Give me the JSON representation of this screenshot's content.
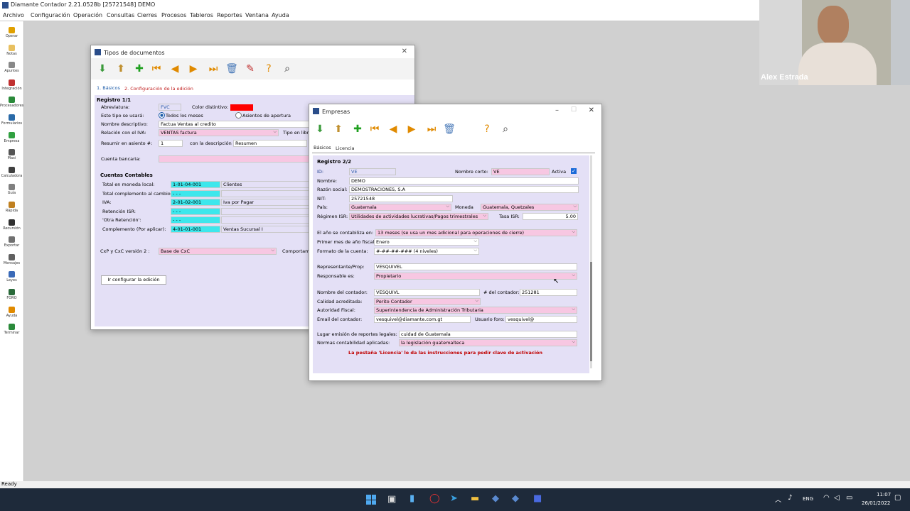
{
  "app": {
    "title": "Diamante Contador 2.21.0528b [25721548] DEMO",
    "menu": [
      "Archivo",
      "Configuración",
      "Operación",
      "Consultas",
      "Cierres",
      "Procesos",
      "Tableros",
      "Reportes",
      "Ventana",
      "Ayuda"
    ],
    "status": "Ready"
  },
  "sidebar": [
    {
      "label": "Operar",
      "icon": "lightning-icon",
      "color": "#e0a000"
    },
    {
      "label": "Notas",
      "icon": "note-icon",
      "color": "#e8c060"
    },
    {
      "label": "Apuntes",
      "icon": "document-icon",
      "color": "#888888"
    },
    {
      "label": "Integración",
      "icon": "integration-icon",
      "color": "#c03030"
    },
    {
      "label": "Procesadores",
      "icon": "excel-icon",
      "color": "#2a8a3a"
    },
    {
      "label": "Formularios",
      "icon": "form-icon",
      "color": "#2a6aa8"
    },
    {
      "label": "Empresa",
      "icon": "company-icon",
      "color": "#30a040"
    },
    {
      "label": "Maxi",
      "icon": "tree-icon",
      "color": "#555555"
    },
    {
      "label": "Calculadora",
      "icon": "calculator-icon",
      "color": "#404040"
    },
    {
      "label": "Guía",
      "icon": "guide-icon",
      "color": "#808080"
    },
    {
      "label": "Rápida",
      "icon": "quick-icon",
      "color": "#c08020"
    },
    {
      "label": "Recursión",
      "icon": "binoculars-icon",
      "color": "#303030"
    },
    {
      "label": "Exportar",
      "icon": "export-icon",
      "color": "#707070"
    },
    {
      "label": "Mensajes",
      "icon": "search-icon",
      "color": "#606060"
    },
    {
      "label": "Leyes",
      "icon": "law-icon",
      "color": "#3a6ab8"
    },
    {
      "label": "FORO",
      "icon": "forum-icon",
      "color": "#2a6a3a"
    },
    {
      "label": "Ayuda",
      "icon": "help-icon",
      "color": "#e08a00"
    },
    {
      "label": "Terminar",
      "icon": "exit-icon",
      "color": "#2a8a3a"
    }
  ],
  "tipos": {
    "title": "Tipos de documentos",
    "tabs": [
      "1. Básicos",
      "2. Configuración de la edición"
    ],
    "registro": "Registro 1/1",
    "abreviatura_label": "Abreviatura:",
    "abreviatura": "FVC",
    "color_label": "Color distintivo:",
    "color_value": "#ff0000",
    "usara_label": "Este tipo se usará:",
    "radio1": "Todos los meses",
    "radio2": "Asientos de apertura",
    "nombre_label": "Nombre descriptivo:",
    "nombre": "Factua Ventas al credito",
    "iva_rel_label": "Relación con el IVA:",
    "iva_rel": "VENTAS factura",
    "tipo_libro_label": "Tipo en libro",
    "resumir_label": "Resumir en asiento #:",
    "resumir": "1",
    "con_desc_label": "con la descripción",
    "con_desc": "Resumen",
    "cuenta_bancaria_label": "Cuenta bancaria:",
    "cuentas_title": "Cuentas Contables",
    "cuentas": [
      {
        "label": "Total en moneda local:",
        "code": "1-01-04-001",
        "name": "Clientes"
      },
      {
        "label": "Total complemento al cambio:",
        "code": "- - -",
        "name": ""
      },
      {
        "label": "IVA:",
        "code": "2-01-02-001",
        "name": "Iva por Pagar"
      },
      {
        "label": "Retención ISR:",
        "code": "- - -",
        "name": ""
      },
      {
        "label": "'Otra Retención':",
        "code": "- - -",
        "name": ""
      },
      {
        "label": "Complemento (Por aplicar):",
        "code": "4-01-01-001",
        "name": "Ventas Sucursal I"
      }
    ],
    "cxp_label": "CxP y CxC versión 2 :",
    "cxp": "Base de CxC",
    "comportam_label": "Comportam",
    "ir_button": "Ir configurar la edición"
  },
  "empresas": {
    "title": "Empresas",
    "tabs": [
      "Básicos",
      "Licencia"
    ],
    "registro": "Registro 2/2",
    "id_label": "ID:",
    "id": "VE",
    "nombre_corto_label": "Nombre corto:",
    "nombre_corto": "VE",
    "activa_label": "Activa",
    "nombre_label": "Nombre:",
    "nombre": "DEMO",
    "razon_label": "Razón social:",
    "razon": "DEMOSTRACIONES, S.A",
    "nit_label": "NIT:",
    "nit": "25721548",
    "pais_label": "País:",
    "pais": "Guatemala",
    "moneda_label": "Moneda",
    "moneda": "Guatemala, Quetzales",
    "regimen_label": "Régimen ISR:",
    "regimen": "Utilidades de actividades lucrativas/Pagos trimestrales",
    "tasa_label": "Tasa ISR:",
    "tasa": "5.00",
    "anio_label": "El año se contabiliza en:",
    "anio": "13 meses (se usa un mes adicional para operaciones de cierre)",
    "primer_mes_label": "Primer mes de año fiscal",
    "primer_mes": "Enero",
    "formato_label": "Formato de la cuenta:",
    "formato": "#-##-##-### (4 niveles)",
    "representante_label": "Representante/Prop:",
    "representante": "VESQUIVEL",
    "responsable_label": "Responsable es:",
    "responsable": "Propietario",
    "contador_label": "Nombre del contador:",
    "contador": "VESQUIVL",
    "num_contador_label": "# del contador:",
    "num_contador": "251281",
    "calidad_label": "Calidad acreditada:",
    "calidad": "Perito Contador",
    "autoridad_label": "Autoridad Fiscal:",
    "autoridad": "Superintendencia de Administración Tributaria",
    "email_label": "Email del contador:",
    "email": "vesquivel@diamante.com.gt",
    "usuario_label": "Usuario foro:",
    "usuario": "vesquivel@",
    "lugar_label": "Lugar emisión de reportes legales:",
    "lugar": "cuidad de Guatemala",
    "normas_label": "Normas contabilidad aplicadas:",
    "normas": "la legislación guatemalteca",
    "licencia_note": "La pestaña 'Licencia' le da las instrucciones  para pedir clave de activación"
  },
  "webcam": {
    "name": "Alex Estrada"
  },
  "taskbar": {
    "lang": "ENG",
    "time": "11:07",
    "date": "26/01/2022"
  }
}
